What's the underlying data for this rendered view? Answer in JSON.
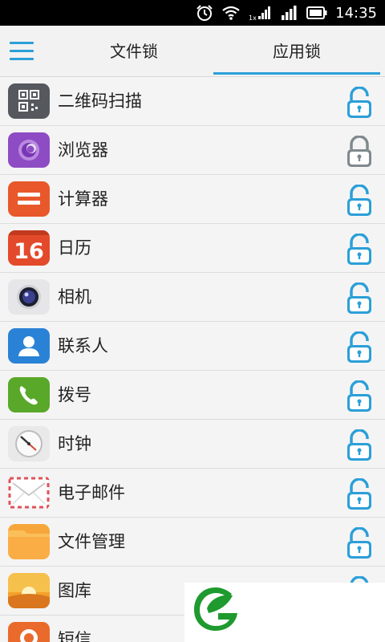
{
  "status_bar": {
    "time": "14:35",
    "icons": [
      "alarm-icon",
      "wifi-icon",
      "signal-1x-icon",
      "signal-icon",
      "battery-icon"
    ]
  },
  "header": {
    "menu_icon": "hamburger-menu-icon",
    "tabs": [
      {
        "label": "文件锁",
        "selected": false
      },
      {
        "label": "应用锁",
        "selected": true
      }
    ],
    "accent_color": "#2b9fd8"
  },
  "apps": [
    {
      "label": "二维码扫描",
      "icon": "qr-scan-icon",
      "locked": false
    },
    {
      "label": "浏览器",
      "icon": "browser-icon",
      "locked": true
    },
    {
      "label": "计算器",
      "icon": "calculator-icon",
      "locked": false
    },
    {
      "label": "日历",
      "icon": "calendar-icon",
      "calendar_day": "16",
      "locked": false
    },
    {
      "label": "相机",
      "icon": "camera-icon",
      "locked": false
    },
    {
      "label": "联系人",
      "icon": "contacts-icon",
      "locked": false
    },
    {
      "label": "拨号",
      "icon": "phone-icon",
      "locked": false
    },
    {
      "label": "时钟",
      "icon": "clock-icon",
      "locked": false
    },
    {
      "label": "电子邮件",
      "icon": "email-icon",
      "locked": false
    },
    {
      "label": "文件管理",
      "icon": "file-manager-icon",
      "locked": false
    },
    {
      "label": "图库",
      "icon": "gallery-icon",
      "locked": false
    },
    {
      "label": "短信",
      "icon": "sms-icon",
      "locked": false
    }
  ],
  "lock_colors": {
    "unlocked": "#2b9fd8",
    "locked": "#7f8a8f"
  },
  "brand": {
    "icon": "green-leaf-logo-icon",
    "color": "#1e9a2e"
  }
}
